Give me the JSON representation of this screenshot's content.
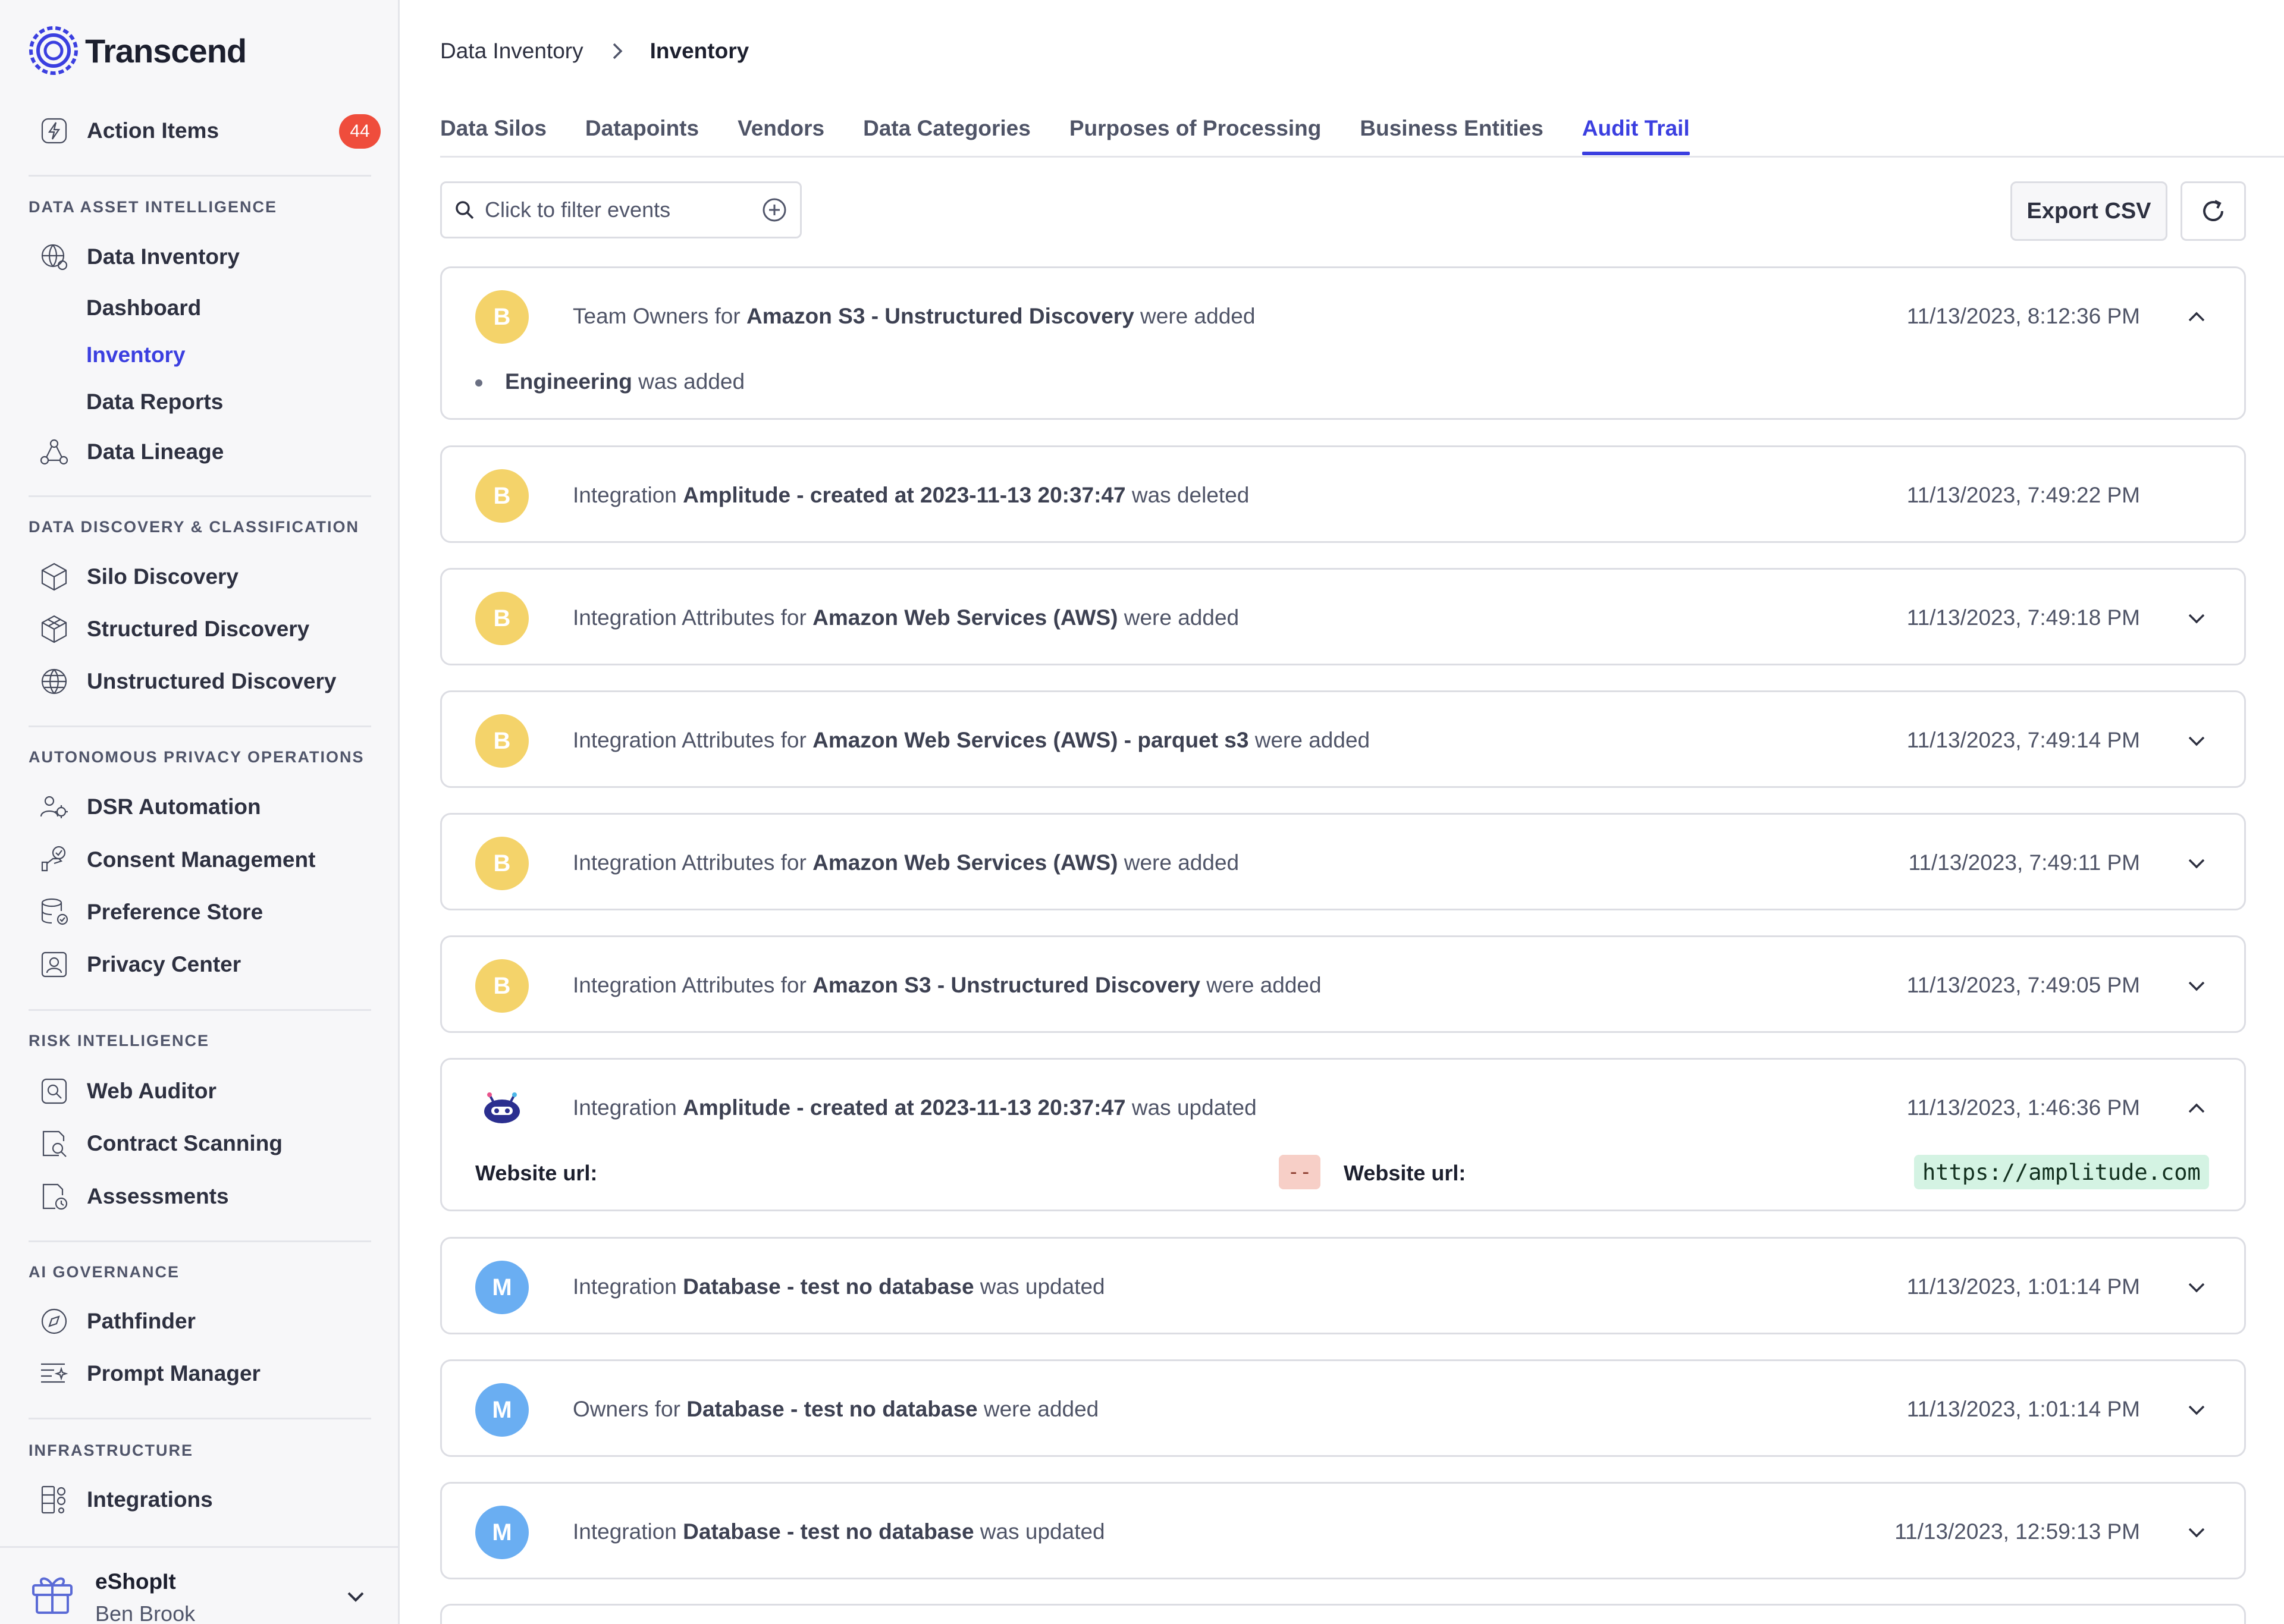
{
  "app": {
    "name": "Transcend"
  },
  "sidebar": {
    "action_items": {
      "label": "Action Items",
      "badge": "44"
    },
    "sections": [
      {
        "title": "DATA ASSET INTELLIGENCE"
      },
      {
        "title": "DATA DISCOVERY & CLASSIFICATION"
      },
      {
        "title": "AUTONOMOUS PRIVACY OPERATIONS"
      },
      {
        "title": "RISK INTELLIGENCE"
      },
      {
        "title": "AI GOVERNANCE"
      },
      {
        "title": "INFRASTRUCTURE"
      }
    ],
    "items": {
      "data_inventory": "Data Inventory",
      "dashboard": "Dashboard",
      "inventory": "Inventory",
      "data_reports": "Data Reports",
      "data_lineage": "Data Lineage",
      "silo_discovery": "Silo Discovery",
      "structured_discovery": "Structured Discovery",
      "unstructured_discovery": "Unstructured Discovery",
      "dsr_automation": "DSR Automation",
      "consent_management": "Consent Management",
      "preference_store": "Preference Store",
      "privacy_center": "Privacy Center",
      "web_auditor": "Web Auditor",
      "contract_scanning": "Contract Scanning",
      "assessments": "Assessments",
      "pathfinder": "Pathfinder",
      "prompt_manager": "Prompt Manager",
      "integrations": "Integrations"
    },
    "workspace": {
      "name": "eShopIt",
      "user": "Ben Brook"
    }
  },
  "breadcrumb": {
    "parent": "Data Inventory",
    "current": "Inventory"
  },
  "tabs": [
    {
      "label": "Data Silos",
      "active": false
    },
    {
      "label": "Datapoints",
      "active": false
    },
    {
      "label": "Vendors",
      "active": false
    },
    {
      "label": "Data Categories",
      "active": false
    },
    {
      "label": "Purposes of Processing",
      "active": false
    },
    {
      "label": "Business Entities",
      "active": false
    },
    {
      "label": "Audit Trail",
      "active": true
    }
  ],
  "toolbar": {
    "filter_placeholder": "Click to filter events",
    "export_label": "Export CSV"
  },
  "events": [
    {
      "avatar": "B",
      "pre": "Team Owners for ",
      "bold": "Amazon S3 - Unstructured Discovery",
      "post": " were added",
      "time": "11/13/2023, 8:12:36 PM",
      "expanded": true,
      "details": {
        "bold": "Engineering",
        "post": " was added"
      }
    },
    {
      "avatar": "B",
      "pre": "Integration ",
      "bold": "Amplitude - created at 2023-11-13 20:37:47",
      "post": " was deleted",
      "time": "11/13/2023, 7:49:22 PM"
    },
    {
      "avatar": "B",
      "pre": "Integration Attributes for ",
      "bold": "Amazon Web Services (AWS)",
      "post": " were added",
      "time": "11/13/2023, 7:49:18 PM"
    },
    {
      "avatar": "B",
      "pre": "Integration Attributes for ",
      "bold": "Amazon Web Services (AWS) - parquet s3",
      "post": " were added",
      "time": "11/13/2023, 7:49:14 PM"
    },
    {
      "avatar": "B",
      "pre": "Integration Attributes for ",
      "bold": "Amazon Web Services (AWS)",
      "post": " were added",
      "time": "11/13/2023, 7:49:11 PM"
    },
    {
      "avatar": "B",
      "pre": "Integration Attributes for ",
      "bold": "Amazon S3 - Unstructured Discovery",
      "post": " were added",
      "time": "11/13/2023, 7:49:05 PM"
    },
    {
      "avatar": "robot",
      "pre": "Integration ",
      "bold": "Amplitude - created at 2023-11-13 20:37:47",
      "post": " was updated",
      "time": "11/13/2023, 1:46:36 PM",
      "expanded": true,
      "diff": {
        "old_label": "Website url:",
        "old_value": "--",
        "new_label": "Website url:",
        "new_value": "https://amplitude.com"
      }
    },
    {
      "avatar": "M",
      "pre": "Integration ",
      "bold": "Database - test no database",
      "post": " was updated",
      "time": "11/13/2023, 1:01:14 PM"
    },
    {
      "avatar": "M",
      "pre": "Owners for ",
      "bold": "Database - test no database",
      "post": " were added",
      "time": "11/13/2023, 1:01:14 PM"
    },
    {
      "avatar": "M",
      "pre": "Integration ",
      "bold": "Database - test no database",
      "post": " was updated",
      "time": "11/13/2023, 12:59:13 PM"
    }
  ],
  "colors": {
    "accent": "#3b3fe0",
    "avatar_b": "#f4d36a",
    "avatar_m": "#6aaef2",
    "badge": "#ef4d3c",
    "diff_removed": "#f7cfc7",
    "diff_added": "#d4f3e3"
  }
}
